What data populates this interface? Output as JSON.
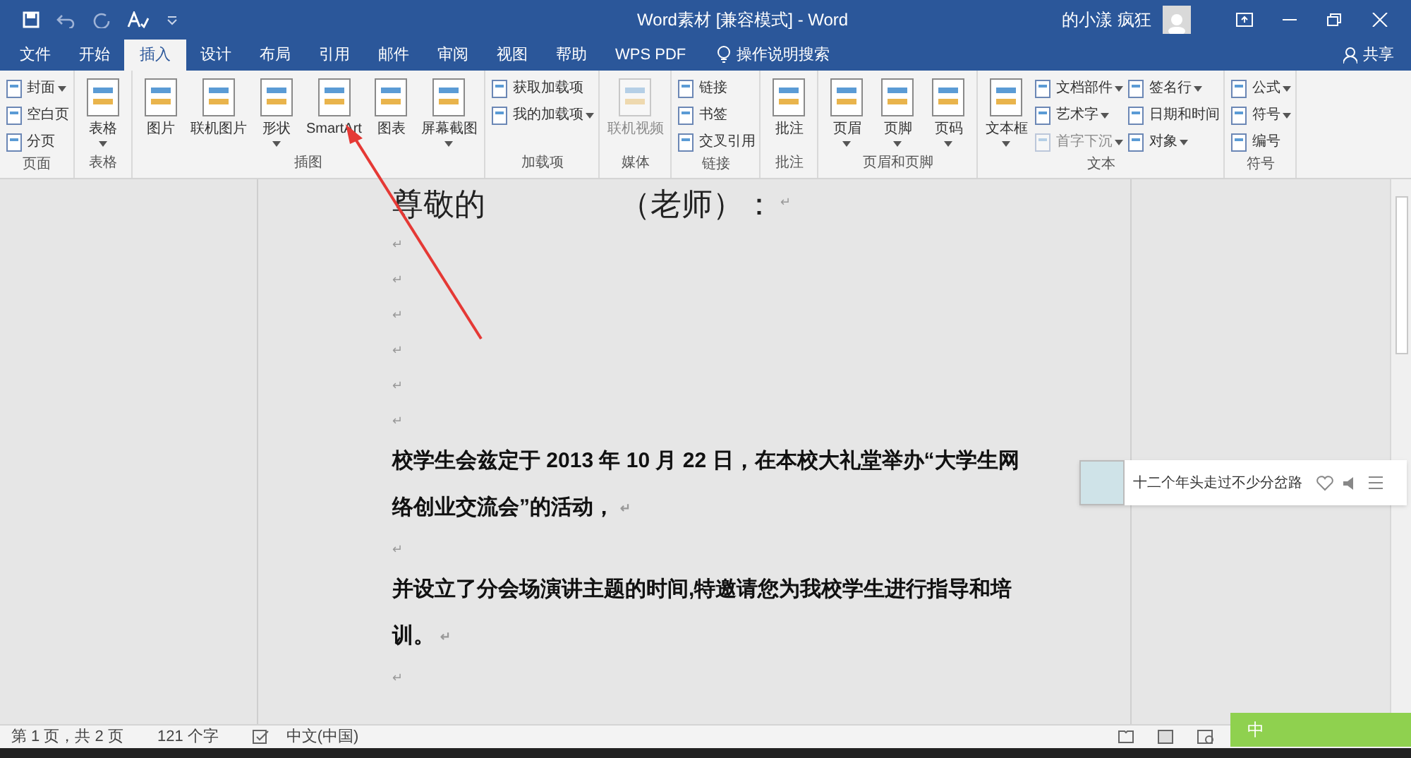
{
  "window": {
    "title": "Word素材 [兼容模式] - Word",
    "user": "的小漾 疯狂"
  },
  "tabs": [
    {
      "label": "文件",
      "selected": false
    },
    {
      "label": "开始",
      "selected": false
    },
    {
      "label": "插入",
      "selected": true
    },
    {
      "label": "设计",
      "selected": false
    },
    {
      "label": "布局",
      "selected": false
    },
    {
      "label": "引用",
      "selected": false
    },
    {
      "label": "邮件",
      "selected": false
    },
    {
      "label": "审阅",
      "selected": false
    },
    {
      "label": "视图",
      "selected": false
    },
    {
      "label": "帮助",
      "selected": false
    },
    {
      "label": "WPS PDF",
      "selected": false
    }
  ],
  "search": {
    "placeholder": "操作说明搜索"
  },
  "share": "共享",
  "ribbon_groups": [
    {
      "label": "页面",
      "items": [
        {
          "kind": "small",
          "label": "封面",
          "dropdown": true,
          "disabled": false
        },
        {
          "kind": "small",
          "label": "空白页",
          "dropdown": false,
          "disabled": false
        },
        {
          "kind": "small",
          "label": "分页",
          "dropdown": false,
          "disabled": false
        }
      ]
    },
    {
      "label": "表格",
      "items": [
        {
          "kind": "large",
          "label": "表格",
          "dropdown": true,
          "disabled": false
        }
      ]
    },
    {
      "label": "插图",
      "items": [
        {
          "kind": "large",
          "label": "图片",
          "dropdown": false,
          "disabled": false
        },
        {
          "kind": "large",
          "label": "联机图片",
          "dropdown": false,
          "disabled": false
        },
        {
          "kind": "large",
          "label": "形状",
          "dropdown": true,
          "disabled": false
        },
        {
          "kind": "large",
          "label": "SmartArt",
          "dropdown": false,
          "disabled": false
        },
        {
          "kind": "large",
          "label": "图表",
          "dropdown": false,
          "disabled": false
        },
        {
          "kind": "large",
          "label": "屏幕截图",
          "dropdown": true,
          "disabled": false
        }
      ]
    },
    {
      "label": "加载项",
      "items": [
        {
          "kind": "small",
          "label": "获取加载项",
          "dropdown": false,
          "disabled": false
        },
        {
          "kind": "small",
          "label": "我的加载项",
          "dropdown": true,
          "disabled": false
        }
      ]
    },
    {
      "label": "媒体",
      "items": [
        {
          "kind": "large",
          "label": "联机视频",
          "dropdown": false,
          "disabled": true
        }
      ]
    },
    {
      "label": "链接",
      "items": [
        {
          "kind": "small",
          "label": "链接",
          "dropdown": false,
          "disabled": false
        },
        {
          "kind": "small",
          "label": "书签",
          "dropdown": false,
          "disabled": false
        },
        {
          "kind": "small",
          "label": "交叉引用",
          "dropdown": false,
          "disabled": false
        }
      ]
    },
    {
      "label": "批注",
      "items": [
        {
          "kind": "large",
          "label": "批注",
          "dropdown": false,
          "disabled": false
        }
      ]
    },
    {
      "label": "页眉和页脚",
      "items": [
        {
          "kind": "large",
          "label": "页眉",
          "dropdown": true,
          "disabled": false
        },
        {
          "kind": "large",
          "label": "页脚",
          "dropdown": true,
          "disabled": false
        },
        {
          "kind": "large",
          "label": "页码",
          "dropdown": true,
          "disabled": false
        }
      ]
    },
    {
      "label": "文本",
      "items": [
        {
          "kind": "large",
          "label": "文本框",
          "dropdown": true,
          "disabled": false
        },
        {
          "kind": "small",
          "label": "文档部件",
          "dropdown": true,
          "disabled": false
        },
        {
          "kind": "small",
          "label": "艺术字",
          "dropdown": true,
          "disabled": false
        },
        {
          "kind": "small",
          "label": "首字下沉",
          "dropdown": true,
          "disabled": true
        },
        {
          "kind": "small",
          "label": "签名行",
          "dropdown": true,
          "disabled": false
        },
        {
          "kind": "small",
          "label": "日期和时间",
          "dropdown": false,
          "disabled": false
        },
        {
          "kind": "small",
          "label": "对象",
          "dropdown": true,
          "disabled": false
        }
      ]
    },
    {
      "label": "符号",
      "items": [
        {
          "kind": "small",
          "label": "公式",
          "dropdown": true,
          "disabled": false
        },
        {
          "kind": "small",
          "label": "符号",
          "dropdown": true,
          "disabled": false
        },
        {
          "kind": "small",
          "label": "编号",
          "dropdown": false,
          "disabled": false
        }
      ]
    }
  ],
  "document": {
    "paragraphs": [
      {
        "kind": "heading",
        "parts": [
          "尊敬的",
          "（老师）："
        ],
        "mark": "↵"
      },
      {
        "kind": "empty",
        "mark": "↵"
      },
      {
        "kind": "empty",
        "mark": "↵"
      },
      {
        "kind": "empty",
        "mark": "↵"
      },
      {
        "kind": "empty",
        "mark": "↵"
      },
      {
        "kind": "empty",
        "mark": "↵"
      },
      {
        "kind": "empty",
        "mark": "↵"
      },
      {
        "kind": "text",
        "lines": [
          "校学生会兹定于 **2013** 年 **10** 月 **22** 日，在本校大礼堂举办“大学生网",
          "络创业交流会”的活动，"
        ],
        "mark": "↵"
      },
      {
        "kind": "empty",
        "mark": "↵"
      },
      {
        "kind": "text",
        "lines": [
          "并设立了分会场演讲主题的时间,特邀请您为我校学生进行指导和培",
          "训。"
        ],
        "mark": "↵"
      },
      {
        "kind": "empty",
        "mark": "↵"
      }
    ]
  },
  "music_popup": {
    "song": "十二个年头走过不少分岔路"
  },
  "ime": {
    "mode": "中"
  },
  "status_bar": {
    "page": "第 1 页，共 2 页",
    "words": "121 个字",
    "language": "中文(中国)"
  }
}
